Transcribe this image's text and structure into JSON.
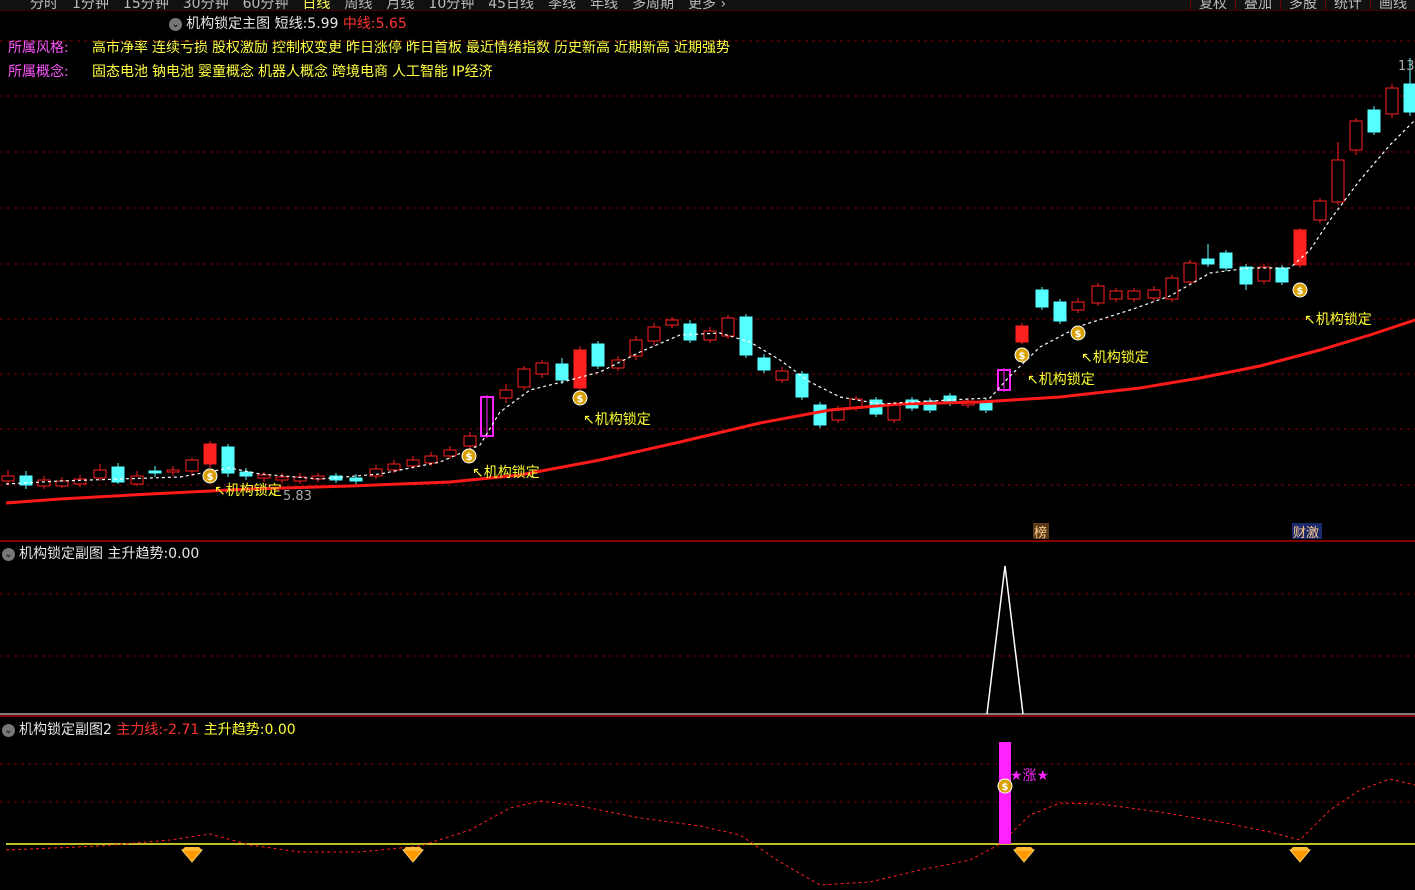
{
  "topbar": {
    "tabs": [
      {
        "label": "分时",
        "active": false
      },
      {
        "label": "1分钟",
        "active": false
      },
      {
        "label": "15分钟",
        "active": false
      },
      {
        "label": "30分钟",
        "active": false
      },
      {
        "label": "60分钟",
        "active": false
      },
      {
        "label": "日线",
        "active": true
      },
      {
        "label": "周线",
        "active": false
      },
      {
        "label": "月线",
        "active": false
      },
      {
        "label": "10分钟",
        "active": false
      },
      {
        "label": "45日线",
        "active": false
      },
      {
        "label": "季线",
        "active": false
      },
      {
        "label": "年线",
        "active": false
      },
      {
        "label": "多周期",
        "active": false
      },
      {
        "label": "更多 ›",
        "active": false
      }
    ],
    "right_buttons": [
      "复权",
      "叠加",
      "多股",
      "统计",
      "画线"
    ]
  },
  "main_panel": {
    "indicator_name": "机构锁定主图",
    "short_line_label": "短线:",
    "short_line_value": "5.99",
    "mid_line_label": "中线:",
    "mid_line_value": "5.65",
    "price_low_label": "5.83",
    "price_high_label": "13",
    "annotation_text": "↖机构锁定",
    "markers": [
      {
        "text": "榜"
      },
      {
        "text": "财激"
      }
    ]
  },
  "info": {
    "style_label": "所属风格:",
    "style_items": [
      "高市净率",
      "连续亏损",
      "股权激励",
      "控制权变更",
      "昨日涨停",
      "昨日首板",
      "最近情绪指数",
      "历史新高",
      "近期新高",
      "近期强势"
    ],
    "concept_label": "所属概念:",
    "concept_items": [
      "固态电池",
      "钠电池",
      "婴童概念",
      "机器人概念",
      "跨境电商",
      "人工智能",
      "IP经济"
    ]
  },
  "sub1": {
    "indicator_name": "机构锁定副图",
    "trend_label": "主升趋势:",
    "trend_value": "0.00"
  },
  "sub2": {
    "indicator_name": "机构锁定副图2",
    "main_force_label": "主力线:",
    "main_force_value": "-2.71",
    "trend_label": "主升趋势:",
    "trend_value": "0.00",
    "signal_text": "★涨★"
  },
  "colors": {
    "up": "#ff2020",
    "down": "#55ffff",
    "mid_line": "#ff1a1a",
    "short_line": "#ffffff",
    "grid": "#7a0000",
    "annotation": "#ffff33",
    "magenta": "#ff22ff"
  }
}
